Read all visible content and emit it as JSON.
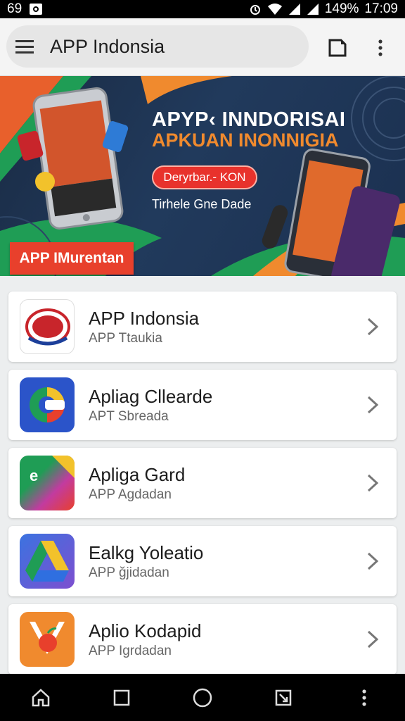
{
  "status_bar": {
    "left_number": "69",
    "battery": "149%",
    "time": "17:09",
    "icons": [
      "image-notification-icon",
      "alarm-icon",
      "wifi-icon",
      "signal-icon",
      "signal-icon"
    ]
  },
  "app_bar": {
    "title": "APP Indonsia",
    "icons": [
      "hamburger-menu-icon",
      "tab-icon",
      "more-vert-icon"
    ]
  },
  "banner": {
    "title_line1": "APYP‹ INNDORISAI",
    "title_line2": "APKUAN INONNIGIA",
    "button_label": "Deryrbar.- KON",
    "subtitle": "Tirhele Gne Dade",
    "badge_label": "APP IMurentan",
    "colors": {
      "accent_orange": "#f08a2e",
      "accent_red": "#e8322c",
      "green": "#1f9d55",
      "navy": "#1a2b44"
    }
  },
  "apps": [
    {
      "title": "APP Indonsia",
      "subtitle": "APP Ttaukia",
      "icon": "red-badge-app-icon"
    },
    {
      "title": "Apliag Cllearde",
      "subtitle": "APT Sbreada",
      "icon": "google-style-app-icon"
    },
    {
      "title": "Apliga Gard",
      "subtitle": "APP Agdadan",
      "icon": "gradient-folder-app-icon"
    },
    {
      "title": "Ealkg Yoleatio",
      "subtitle": "APP ğjidadan",
      "icon": "drive-triangle-app-icon"
    },
    {
      "title": "Aplio Kodapid",
      "subtitle": "APP Igrdadan",
      "icon": "orange-fruit-app-icon"
    }
  ],
  "nav_bar": {
    "buttons": [
      "home-icon",
      "recents-square-icon",
      "home-circle-icon",
      "screenshot-icon",
      "more-vert-icon"
    ]
  }
}
